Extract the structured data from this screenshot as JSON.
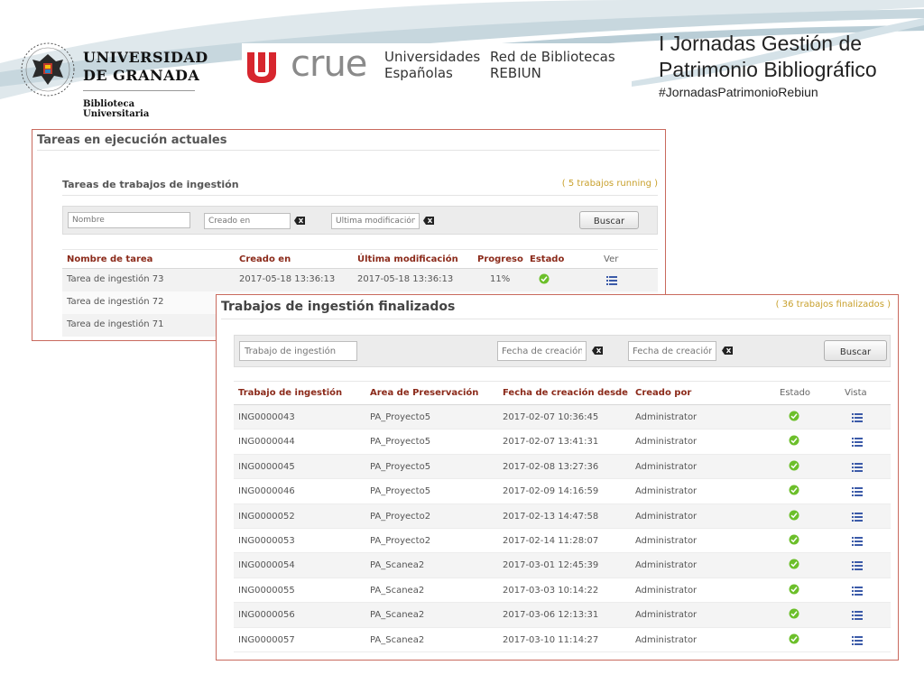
{
  "header": {
    "ugr_line1": "UNIVERSIDAD",
    "ugr_line2": "DE GRANADA",
    "ugr_sub": "Biblioteca Universitaria",
    "crue_word": "crue",
    "crue_text1_l1": "Universidades",
    "crue_text1_l2": "Españolas",
    "crue_text2_l1": "Red de Bibliotecas",
    "crue_text2_l2": "REBIUN",
    "title_line1": "I Jornadas Gestión de",
    "title_line2": "Patrimonio Bibliográfico",
    "hashtag": "#JornadasPatrimonioRebiun"
  },
  "colors": {
    "accent_red": "#c0392b",
    "panel_border": "#c96a5e",
    "header_text": "#8b2a1a",
    "count_gold": "#c8a02c",
    "ok_green": "#6cbf2a"
  },
  "panel1": {
    "title": "Tareas en ejecución actuales",
    "subtitle": "Tareas de trabajos de ingestión",
    "count": "( 5 trabajos running )",
    "filter": {
      "name_placeholder": "Nombre",
      "created_placeholder": "Creado en",
      "modified_placeholder": "Última modificación",
      "search_label": "Buscar"
    },
    "columns": [
      "Nombre de tarea",
      "Creado en",
      "Última modificación",
      "Progreso",
      "Estado",
      "Ver"
    ],
    "rows": [
      {
        "name": "Tarea de ingestión 73",
        "created": "2017-05-18 13:36:13",
        "modified": "2017-05-18 13:36:13",
        "progress": "11%",
        "status_icon": "check-circle-icon",
        "view_icon": "list-icon"
      },
      {
        "name": "Tarea de ingestión 72"
      },
      {
        "name": "Tarea de ingestión 71"
      }
    ]
  },
  "panel2": {
    "title": "Trabajos de ingestión finalizados",
    "count": "( 36 trabajos finalizados )",
    "filter": {
      "job_placeholder": "Trabajo de ingestión",
      "from_placeholder": "Fecha de creación de",
      "to_placeholder": "Fecha de creación ha",
      "search_label": "Buscar"
    },
    "columns": [
      "Trabajo de ingestión",
      "Area de Preservación",
      "Fecha de creación desde",
      "Creado por",
      "Estado",
      "Vista"
    ],
    "rows": [
      {
        "job": "ING0000043",
        "area": "PA_Proyecto5",
        "date": "2017-02-07 10:36:45",
        "by": "Administrator"
      },
      {
        "job": "ING0000044",
        "area": "PA_Proyecto5",
        "date": "2017-02-07 13:41:31",
        "by": "Administrator"
      },
      {
        "job": "ING0000045",
        "area": "PA_Proyecto5",
        "date": "2017-02-08 13:27:36",
        "by": "Administrator"
      },
      {
        "job": "ING0000046",
        "area": "PA_Proyecto5",
        "date": "2017-02-09 14:16:59",
        "by": "Administrator"
      },
      {
        "job": "ING0000052",
        "area": "PA_Proyecto2",
        "date": "2017-02-13 14:47:58",
        "by": "Administrator"
      },
      {
        "job": "ING0000053",
        "area": "PA_Proyecto2",
        "date": "2017-02-14 11:28:07",
        "by": "Administrator"
      },
      {
        "job": "ING0000054",
        "area": "PA_Scanea2",
        "date": "2017-03-01 12:45:39",
        "by": "Administrator"
      },
      {
        "job": "ING0000055",
        "area": "PA_Scanea2",
        "date": "2017-03-03 10:14:22",
        "by": "Administrator"
      },
      {
        "job": "ING0000056",
        "area": "PA_Scanea2",
        "date": "2017-03-06 12:13:31",
        "by": "Administrator"
      },
      {
        "job": "ING0000057",
        "area": "PA_Scanea2",
        "date": "2017-03-10 11:14:27",
        "by": "Administrator"
      }
    ]
  }
}
